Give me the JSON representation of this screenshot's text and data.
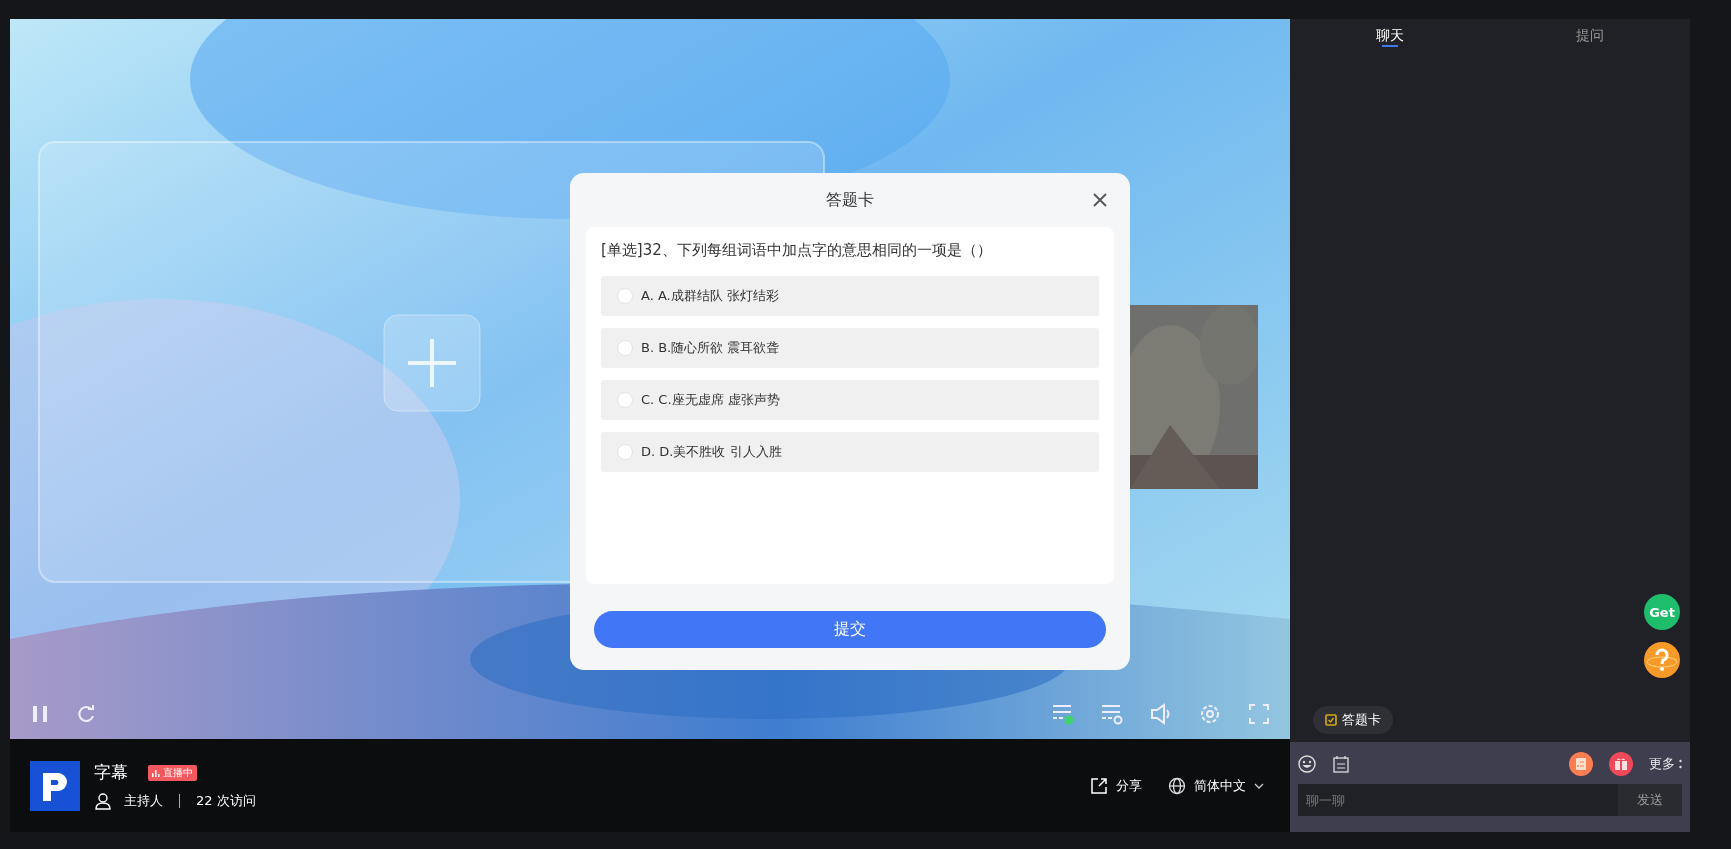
{
  "tabs": [
    {
      "label": "聊天",
      "selected": true
    },
    {
      "label": "提问",
      "selected": false
    }
  ],
  "quiz_dialog": {
    "title": "答题卡",
    "question": "[单选]32、下列每组词语中加点字的意思相同的一项是（）",
    "options": [
      {
        "label": "A. A.成群结队 张灯结彩",
        "selected": false
      },
      {
        "label": "B. B.随心所欲 震耳欲聋",
        "selected": false
      },
      {
        "label": "C. C.座无虚席 虚张声势",
        "selected": false
      },
      {
        "label": "D. D.美不胜收 引人入胜",
        "selected": false
      }
    ],
    "submit": "提交"
  },
  "stream_info": {
    "title": "字幕",
    "live_badge": "直播中",
    "host": "主持人",
    "visits": "22 次访问",
    "share": "分享",
    "language": "简体中文"
  },
  "chat": {
    "get_badge": "Get",
    "answer_card_chip": "答题卡",
    "more": "更多",
    "input_placeholder": "聊一聊",
    "send": "发送"
  }
}
